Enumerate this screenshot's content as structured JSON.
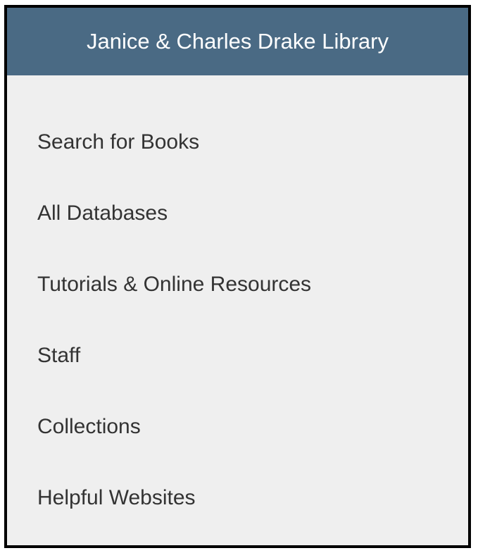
{
  "panel": {
    "title": "Janice & Charles Drake Library",
    "items": [
      {
        "label": "Search for Books"
      },
      {
        "label": "All Databases"
      },
      {
        "label": "Tutorials & Online Resources"
      },
      {
        "label": "Staff"
      },
      {
        "label": "Collections"
      },
      {
        "label": "Helpful Websites"
      }
    ]
  },
  "colors": {
    "header_bg": "#4a6a84",
    "panel_bg": "#efefef",
    "border": "#000000",
    "item_text": "#333333"
  }
}
